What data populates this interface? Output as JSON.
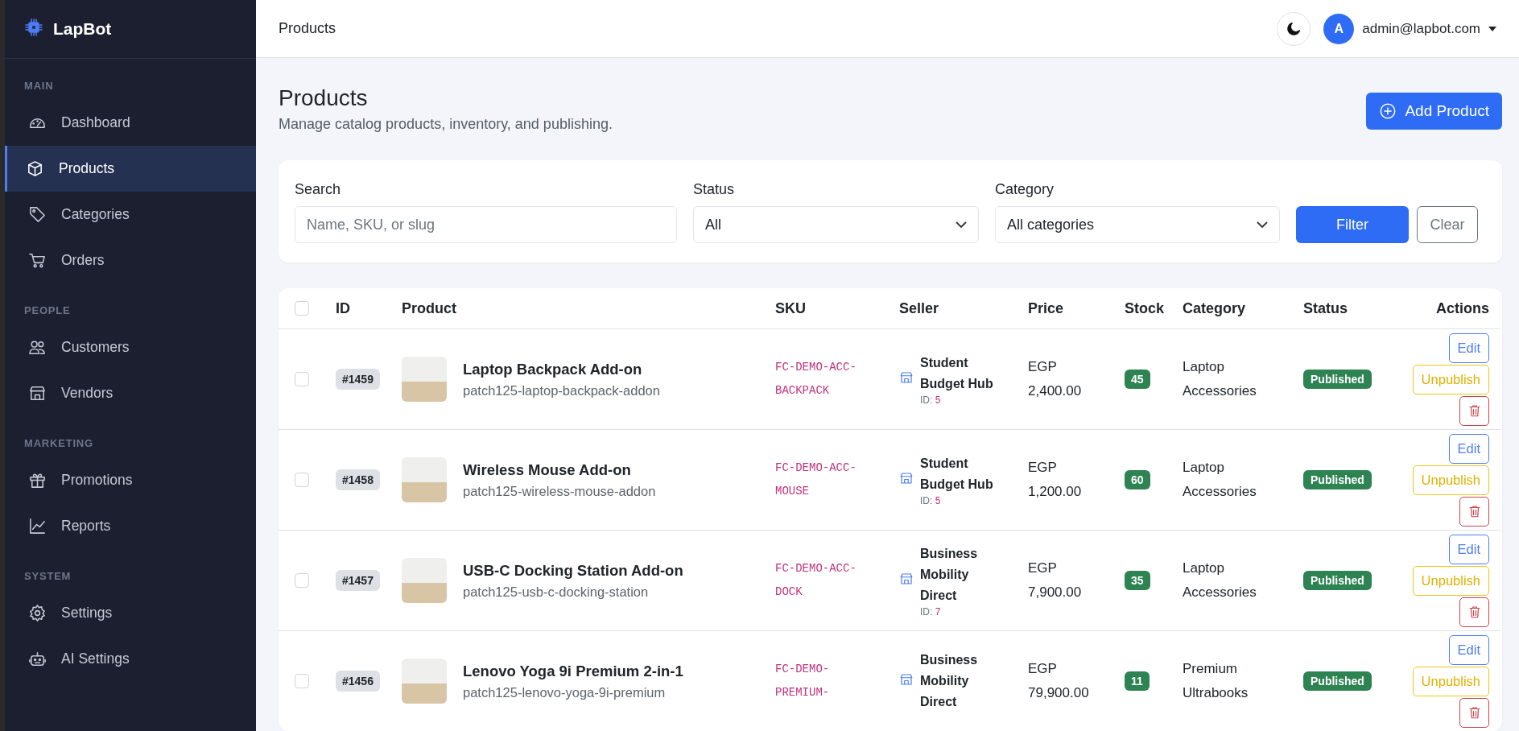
{
  "brand": {
    "name": "LapBot"
  },
  "sidebar": {
    "sections": [
      {
        "title": "MAIN",
        "items": [
          {
            "label": "Dashboard",
            "selected": false
          },
          {
            "label": "Products",
            "selected": true
          },
          {
            "label": "Categories",
            "selected": false
          },
          {
            "label": "Orders",
            "selected": false
          }
        ]
      },
      {
        "title": "PEOPLE",
        "items": [
          {
            "label": "Customers",
            "selected": false
          },
          {
            "label": "Vendors",
            "selected": false
          }
        ]
      },
      {
        "title": "MARKETING",
        "items": [
          {
            "label": "Promotions",
            "selected": false
          },
          {
            "label": "Reports",
            "selected": false
          }
        ]
      },
      {
        "title": "SYSTEM",
        "items": [
          {
            "label": "Settings",
            "selected": false
          },
          {
            "label": "AI Settings",
            "selected": false
          }
        ]
      }
    ]
  },
  "topbar": {
    "breadcrumb": "Products",
    "avatar_letter": "A",
    "user_email": "admin@lapbot.com"
  },
  "page": {
    "title": "Products",
    "subtitle": "Manage catalog products, inventory, and publishing.",
    "add_button": "Add Product"
  },
  "filters": {
    "search": {
      "label": "Search",
      "placeholder": "Name, SKU, or slug"
    },
    "status": {
      "label": "Status",
      "value": "All"
    },
    "category": {
      "label": "Category",
      "value": "All categories"
    },
    "filter_button": "Filter",
    "clear_button": "Clear"
  },
  "table": {
    "header_checked": false,
    "columns": [
      "ID",
      "Product",
      "SKU",
      "Seller",
      "Price",
      "Stock",
      "Category",
      "Status",
      "Actions"
    ],
    "rows": [
      {
        "checked": false,
        "id": "#1459",
        "name": "Laptop Backpack Add-on",
        "slug": "patch125-laptop-backpack-addon",
        "sku": "FC-DEMO-ACC-BACKPACK",
        "seller": "Student Budget Hub",
        "seller_id_label": "ID:",
        "seller_id": "5",
        "price": "EGP 2,400.00",
        "stock": "45",
        "category": "Laptop Accessories",
        "status": "Published",
        "actions": [
          "Edit",
          "Unpublish"
        ]
      },
      {
        "checked": false,
        "id": "#1458",
        "name": "Wireless Mouse Add-on",
        "slug": "patch125-wireless-mouse-addon",
        "sku": "FC-DEMO-ACC-MOUSE",
        "seller": "Student Budget Hub",
        "seller_id_label": "ID:",
        "seller_id": "5",
        "price": "EGP 1,200.00",
        "stock": "60",
        "category": "Laptop Accessories",
        "status": "Published",
        "actions": [
          "Edit",
          "Unpublish"
        ]
      },
      {
        "checked": false,
        "id": "#1457",
        "name": "USB-C Docking Station Add-on",
        "slug": "patch125-usb-c-docking-station",
        "sku": "FC-DEMO-ACC-DOCK",
        "seller": "Business Mobility Direct",
        "seller_id_label": "ID:",
        "seller_id": "7",
        "price": "EGP 7,900.00",
        "stock": "35",
        "category": "Laptop Accessories",
        "status": "Published",
        "actions": [
          "Edit",
          "Unpublish"
        ]
      },
      {
        "checked": false,
        "id": "#1456",
        "name": "Lenovo Yoga 9i Premium 2-in-1",
        "slug": "patch125-lenovo-yoga-9i-premium",
        "sku": "FC-DEMO-PREMIUM-",
        "seller": "Business Mobility Direct",
        "price": "EGP 79,900.00",
        "stock": "11",
        "category": "Premium Ultrabooks",
        "status": "Published",
        "actions": [
          "Edit",
          "Unpublish"
        ]
      }
    ]
  }
}
